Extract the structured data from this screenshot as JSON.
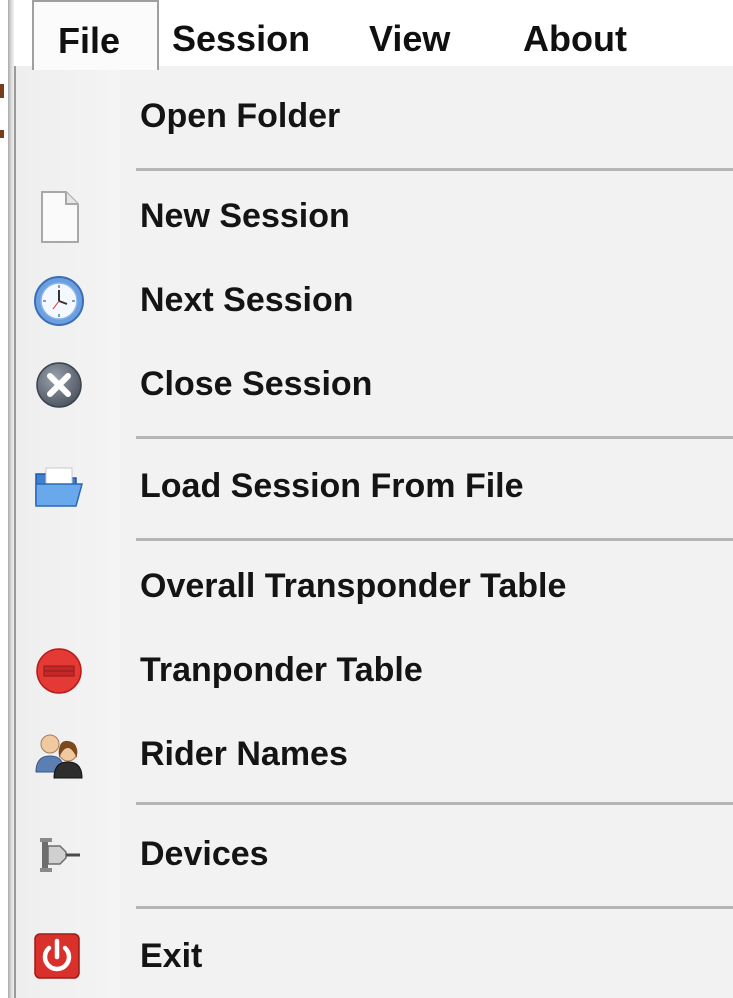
{
  "menubar": {
    "items": [
      {
        "label": "File",
        "active": true
      },
      {
        "label": "Session"
      },
      {
        "label": "View"
      },
      {
        "label": "About"
      }
    ]
  },
  "file_menu": {
    "items": [
      {
        "label": "Open Folder",
        "icon": "none"
      },
      {
        "label": "New Session",
        "icon": "blank-document-icon"
      },
      {
        "label": "Next Session",
        "icon": "clock-icon"
      },
      {
        "label": "Close Session",
        "icon": "close-circle-icon"
      },
      {
        "label": "Load Session From File",
        "icon": "open-folder-icon"
      },
      {
        "label": "Overall Transponder Table",
        "icon": "none"
      },
      {
        "label": "Tranponder Table",
        "icon": "red-table-icon"
      },
      {
        "label": "Rider Names",
        "icon": "users-icon"
      },
      {
        "label": "Devices",
        "icon": "plug-icon"
      },
      {
        "label": "Exit",
        "icon": "power-icon"
      }
    ]
  },
  "colors": {
    "menu_background": "#f2f2f2",
    "separator": "#b5b5b5",
    "text": "#141414",
    "exit_icon": "#d9302b",
    "table_icon": "#e53935"
  }
}
